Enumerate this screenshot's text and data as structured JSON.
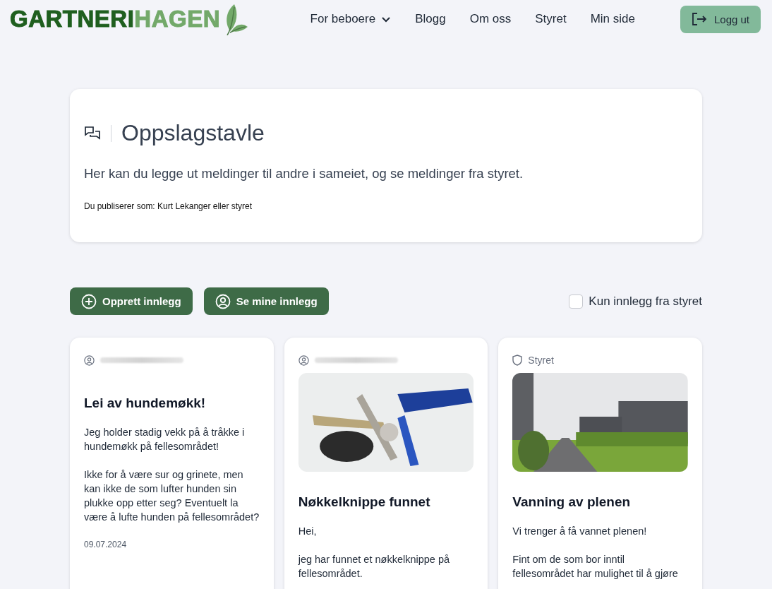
{
  "logo": {
    "part_1": "GARTNERI",
    "part_2": "HAGEN"
  },
  "nav": [
    {
      "label": "For beboere",
      "dropdown": true
    },
    {
      "label": "Blogg",
      "dropdown": false
    },
    {
      "label": "Om oss",
      "dropdown": false
    },
    {
      "label": "Styret",
      "dropdown": false
    },
    {
      "label": "Min side",
      "dropdown": false
    }
  ],
  "logout_button": "Logg ut",
  "intro": {
    "title": "Oppslagstavle",
    "description": "Her kan du legge ut meldinger til andre i sameiet, og se meldinger fra styret.",
    "publishing_as": "Du publiserer som: Kurt Lekanger eller styret"
  },
  "actions": [
    {
      "label": "Opprett innlegg",
      "kind": "create"
    },
    {
      "label": "Se mine innlegg",
      "kind": "mine"
    }
  ],
  "filter": {
    "label": "Kun innlegg fra styret",
    "checked": false
  },
  "posts": [
    {
      "kind": "text",
      "title": "Lei av hundemøkk!",
      "paragraphs": [
        "Jeg holder stadig vekk på å tråkke i hundemøkk på fellesområdet!",
        "Ikke for å være sur og grinete, men kan ikke de som lufter hunden sin plukke opp etter seg? Eventuelt la være å lufte hunden på fellesområdet?"
      ],
      "date": "09.07.2024"
    },
    {
      "kind": "photo",
      "title": "Nøkkelknippe funnet",
      "paragraphs": [
        "Hei,",
        "jeg har funnet et nøkkelknippe på fellesområdet."
      ]
    },
    {
      "kind": "board",
      "author": "Styret",
      "title": "Vanning av plenen",
      "paragraphs": [
        "Vi trenger å få vannet plenen!",
        "Fint om de som bor inntil fellesområdet har mulighet til å gjøre"
      ]
    }
  ]
}
